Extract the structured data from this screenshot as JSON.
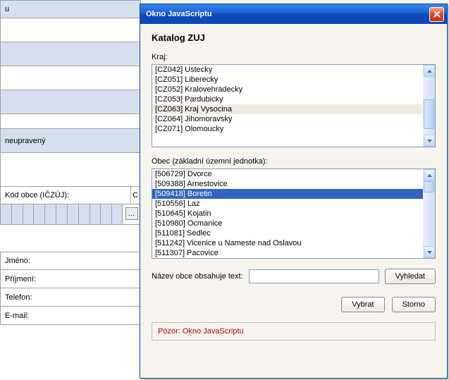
{
  "bg": {
    "row0": "u",
    "row_unupraveny": "neupravený",
    "kod_label": "Kód obce (IČZÚJ):",
    "jmeno": "Jméno:",
    "prijmeni": "Příjmení:",
    "telefon": "Telefon:",
    "email": "E-mail:",
    "col_c": "C"
  },
  "dialog": {
    "title": "Okno JavaScriptu",
    "heading": "Katalog ZUJ",
    "kraj_label": "Kraj:",
    "kraj_items": [
      "[CZ042] Ustecky",
      "[CZ051] Liberecky",
      "[CZ052] Kralovehradecky",
      "[CZ053] Pardubicky",
      "[CZ063] Kraj Vysocina",
      "[CZ064] Jihomoravsky",
      "[CZ071] Olomoucky"
    ],
    "obec_label": "Obec (základní územní jednotka):",
    "obec_items": [
      "[506729] Dvorce",
      "[509388] Arnestovice",
      "[509418] Boretin",
      "[510556] Laz",
      "[510645] Kojatin",
      "[510980] Ocmanice",
      "[511081] Sedlec",
      "[511242] Vicenice u Nameste nad Oslavou",
      "[511307] Pacovice"
    ],
    "search_label": "Název obce obsahuje text:",
    "search_value": "",
    "btn_search": "Vyhledat",
    "btn_select": "Vybrat",
    "btn_cancel": "Storno",
    "footer": "Pozor: Okno JavaScriptu"
  }
}
